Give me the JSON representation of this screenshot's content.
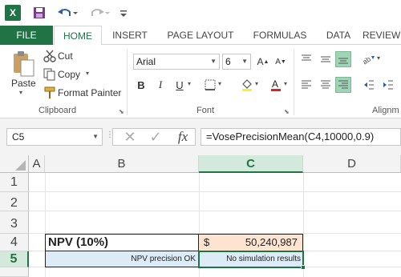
{
  "quick_access": {
    "logo": "X",
    "icons": [
      "excel-logo",
      "save-icon",
      "undo-icon",
      "redo-icon",
      "more-icon"
    ]
  },
  "tabs": [
    "FILE",
    "HOME",
    "INSERT",
    "PAGE LAYOUT",
    "FORMULAS",
    "DATA",
    "REVIEW"
  ],
  "ribbon": {
    "clipboard": {
      "paste": "Paste",
      "cut": "Cut",
      "copy": "Copy",
      "format_painter": "Format Painter",
      "label": "Clipboard"
    },
    "font": {
      "name": "Arial",
      "size": "6",
      "bold": "B",
      "italic": "I",
      "underline": "U",
      "label": "Font"
    },
    "alignment": {
      "label": "Alignm"
    }
  },
  "formula_bar": {
    "name_box": "C5",
    "cancel": "✕",
    "enter": "✓",
    "fx": "fx",
    "formula": "=VosePrecisionMean(C4,10000,0.9)"
  },
  "sheet": {
    "columns": [
      "A",
      "B",
      "C",
      "D"
    ],
    "rows": [
      "1",
      "2",
      "3",
      "4",
      "5"
    ],
    "b4": "NPV (10%)",
    "c4_currency": "$",
    "c4_value": "50,240,987",
    "b5": "NPV precision OK",
    "c5": "No simulation results"
  },
  "colors": {
    "accent": "#217346",
    "header_active": "#d2e9dc",
    "input_fill": "#fce4d0",
    "status_fill": "#ddebf7"
  }
}
